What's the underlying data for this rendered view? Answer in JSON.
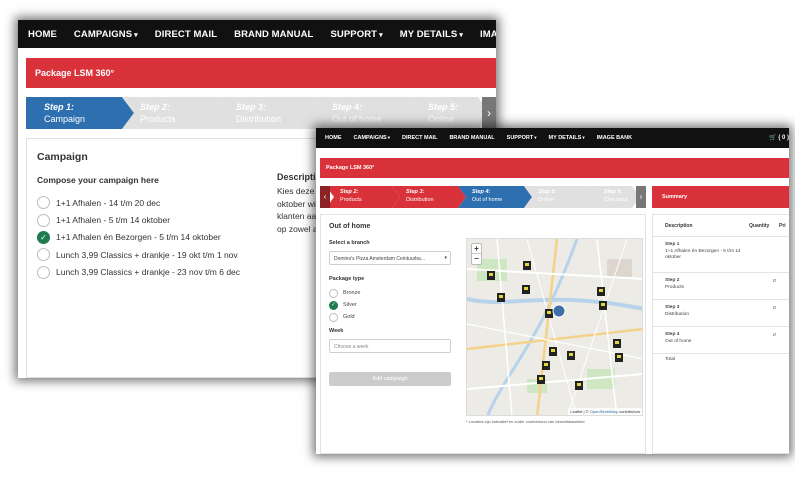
{
  "back": {
    "nav": [
      {
        "label": "HOME",
        "caret": ""
      },
      {
        "label": "CAMPAIGNS",
        "caret": "▾"
      },
      {
        "label": "DIRECT MAIL",
        "caret": ""
      },
      {
        "label": "BRAND MANUAL",
        "caret": ""
      },
      {
        "label": "SUPPORT",
        "caret": "▾"
      },
      {
        "label": "MY DETAILS",
        "caret": "▾"
      },
      {
        "label": "IMAGE BANK",
        "caret": ""
      }
    ],
    "banner": "Package LSM 360°",
    "steps": [
      {
        "num": "Step 1:",
        "label": "Campaign",
        "state": "active"
      },
      {
        "num": "Step 2:",
        "label": "Products",
        "state": "inactive"
      },
      {
        "num": "Step 3:",
        "label": "Distribution",
        "state": "inactive"
      },
      {
        "num": "Step 4:",
        "label": "Out of home",
        "state": "inactive"
      },
      {
        "num": "Step 5:",
        "label": "Online",
        "state": "inactive"
      }
    ],
    "more_glyph": "›",
    "campaign_title": "Campaign",
    "compose_label": "Compose your campaign here",
    "options": [
      {
        "label": "1+1 Afhalen - 14 t/m 20 dec",
        "checked": false
      },
      {
        "label": "1+1 Afhalen - 5 t/m 14 oktober",
        "checked": false
      },
      {
        "label": "1+1 Afhalen én Bezorgen - 5 t/m 14 oktober",
        "checked": true
      },
      {
        "label": "Lunch 3,99 Classics + drankje - 19 okt t/m 1 nov",
        "checked": false
      },
      {
        "label": "Lunch 3,99 Classics + drankje - 23 nov t/m 6 dec",
        "checked": false
      }
    ],
    "description_title": "Description",
    "description_lines": [
      "Kies deze cam",
      "oktober wil la",
      "klanten aan w",
      "op zowel afha"
    ]
  },
  "front": {
    "nav": [
      {
        "label": "HOME",
        "caret": ""
      },
      {
        "label": "CAMPAIGNS",
        "caret": "▾"
      },
      {
        "label": "DIRECT MAIL",
        "caret": ""
      },
      {
        "label": "BRAND MANUAL",
        "caret": ""
      },
      {
        "label": "SUPPORT",
        "caret": "▾"
      },
      {
        "label": "MY DETAILS",
        "caret": "▾"
      },
      {
        "label": "IMAGE BANK",
        "caret": ""
      }
    ],
    "cart_label": "🛒 ( 0 )",
    "banner": "Package LSM 360°",
    "steps": [
      {
        "num": "Step 2:",
        "label": "Products",
        "state": "done"
      },
      {
        "num": "Step 3:",
        "label": "Distribution",
        "state": "done"
      },
      {
        "num": "Step 4:",
        "label": "Out of home",
        "state": "active"
      },
      {
        "num": "Step 5:",
        "label": "Online",
        "state": "inactive"
      },
      {
        "num": "Step 6:",
        "label": "Checkout",
        "state": "inactive"
      }
    ],
    "prev_glyph": "‹",
    "next_glyph": "›",
    "section_title": "Out of home",
    "branch_label": "Select a branch",
    "branch_value": "Domino's Pizza Amsterdam Ceintuurba...",
    "package_type_label": "Package type",
    "packages": [
      {
        "label": "Bronze",
        "checked": false
      },
      {
        "label": "Silver",
        "checked": true
      },
      {
        "label": "Gold",
        "checked": false
      }
    ],
    "week_label": "Week",
    "week_placeholder": "Choose a week",
    "add_button": "Add campaign",
    "map": {
      "zoom_in": "+",
      "zoom_out": "−",
      "attribution_prefix": "Leaflet | © ",
      "attribution_link": "OpenStreetMap",
      "attribution_suffix": " contributors",
      "note": "* Locaties zijn indicatief en onder voorbehoud van beschikbaarheid"
    },
    "summary": {
      "title": "Summary",
      "col_description": "Description",
      "col_quantity": "Quantity",
      "col_price": "Pri",
      "rows": [
        {
          "step": "Step 1",
          "name": "1+1 Afhalen én Bezorgen - 5 t/m 14 oktober",
          "qty": ""
        },
        {
          "step": "Step 2",
          "name": "Products",
          "qty": "0"
        },
        {
          "step": "Step 3",
          "name": "Distribution",
          "qty": "0"
        },
        {
          "step": "Step 4",
          "name": "Out of home",
          "qty": "0"
        }
      ],
      "total_label": "Total"
    }
  },
  "colors": {
    "brand_red": "#d9323a",
    "active_blue": "#2e6fb0",
    "check_green": "#1f7a4d",
    "nav_black": "#111111"
  }
}
